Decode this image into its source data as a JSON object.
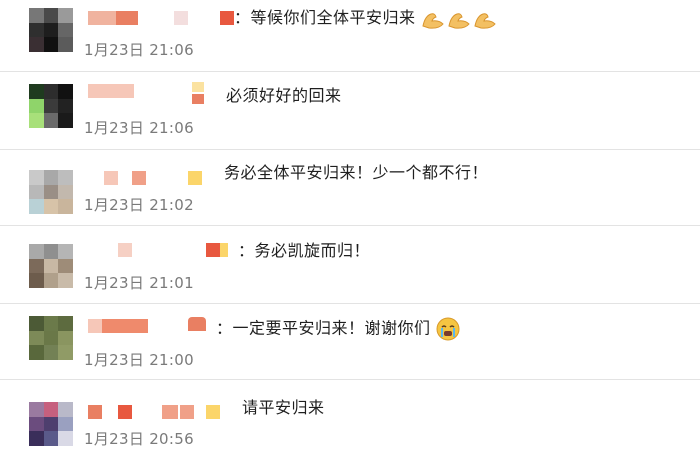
{
  "comments": [
    {
      "text": "：等候你们全体平安归来",
      "time": "1月23日 21:06",
      "emoji": "flexed-biceps-x3",
      "avatar": [
        "#777777",
        "#4a4a4a",
        "#9a9a9a",
        "#2f2f2f",
        "#1e1e1e",
        "#666666",
        "#3a2f33",
        "#111111",
        "#5b5b5b"
      ]
    },
    {
      "text": "必须好好的回来",
      "time": "1月23日 21:06",
      "emoji": "",
      "avatar": [
        "#1f3b1f",
        "#2d2d2d",
        "#111111",
        "#8fd46a",
        "#3b3b3b",
        "#222222",
        "#a8e07a",
        "#6a6a6a",
        "#1a1a1a"
      ]
    },
    {
      "text": "务必全体平安归来！少一个都不行！",
      "time": "1月23日 21:02",
      "emoji": "",
      "avatar": [
        "#c9c9c9",
        "#a8a8a8",
        "#bdbdbd",
        "#b8b8b8",
        "#9a8f86",
        "#c2b8ad",
        "#b9d1d6",
        "#d7c3a8",
        "#c9b59c"
      ]
    },
    {
      "text": "：务必凯旋而归！",
      "time": "1月23日 21:01",
      "emoji": "",
      "avatar": [
        "#a9a9a9",
        "#8f8f8f",
        "#b5b5b5",
        "#7c6a5a",
        "#c8b8a4",
        "#9e8c78",
        "#6d5c4c",
        "#b0a08b",
        "#c9bba9"
      ]
    },
    {
      "text": "：一定要平安归来！谢谢你们",
      "time": "1月23日 21:00",
      "emoji": "crying-face",
      "avatar": [
        "#4c5a36",
        "#6b7a4a",
        "#5d6b3f",
        "#7d8a58",
        "#6a7848",
        "#8a9560",
        "#59683c",
        "#738155",
        "#909b66"
      ]
    },
    {
      "text": "请平安归来",
      "time": "1月23日 20:56",
      "emoji": "",
      "avatar": [
        "#9a7aa0",
        "#c6607e",
        "#b9b9c9",
        "#6b4c7e",
        "#4e3f6e",
        "#9aa0c0",
        "#3a2e5a",
        "#5a5a8a",
        "#d9d9e6"
      ]
    }
  ],
  "colors": {
    "time": "#7a7a7a",
    "divider": "#e3e3e3"
  }
}
